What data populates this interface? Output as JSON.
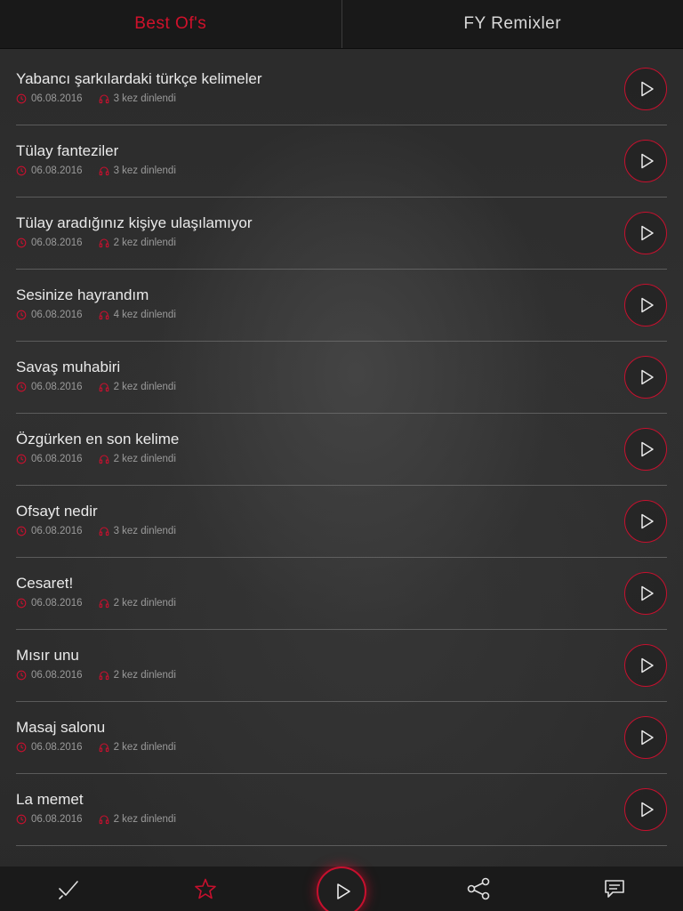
{
  "tabs": [
    {
      "label": "Best Of's",
      "active": true
    },
    {
      "label": "FY Remixler",
      "active": false
    }
  ],
  "items": [
    {
      "title": "Yabancı şarkılardaki türkçe kelimeler",
      "date": "06.08.2016",
      "plays": "3 kez dinlendi"
    },
    {
      "title": "Tülay fanteziler",
      "date": "06.08.2016",
      "plays": "3 kez dinlendi"
    },
    {
      "title": "Tülay aradığınız kişiye ulaşılamıyor",
      "date": "06.08.2016",
      "plays": "2 kez dinlendi"
    },
    {
      "title": "Sesinize hayrandım",
      "date": "06.08.2016",
      "plays": "4 kez dinlendi"
    },
    {
      "title": "Savaş muhabiri",
      "date": "06.08.2016",
      "plays": "2 kez dinlendi"
    },
    {
      "title": "Özgürken en son kelime",
      "date": "06.08.2016",
      "plays": "2 kez dinlendi"
    },
    {
      "title": "Ofsayt nedir",
      "date": "06.08.2016",
      "plays": "3 kez dinlendi"
    },
    {
      "title": "Cesaret!",
      "date": "06.08.2016",
      "plays": "2 kez dinlendi"
    },
    {
      "title": "Mısır unu",
      "date": "06.08.2016",
      "plays": "2 kez dinlendi"
    },
    {
      "title": "Masaj salonu",
      "date": "06.08.2016",
      "plays": "2 kez dinlendi"
    },
    {
      "title": "La memet",
      "date": "06.08.2016",
      "plays": "2 kez dinlendi"
    }
  ],
  "bottom_nav": [
    {
      "icon": "check-icon",
      "active": false
    },
    {
      "icon": "star-icon",
      "active": true
    },
    {
      "icon": "play-icon",
      "active": false,
      "center": true
    },
    {
      "icon": "share-icon",
      "active": false
    },
    {
      "icon": "comment-icon",
      "active": false
    }
  ],
  "colors": {
    "accent": "#c8102e",
    "text": "#eaeaea",
    "meta": "#9a9a9a",
    "background": "#2a2a2a"
  }
}
